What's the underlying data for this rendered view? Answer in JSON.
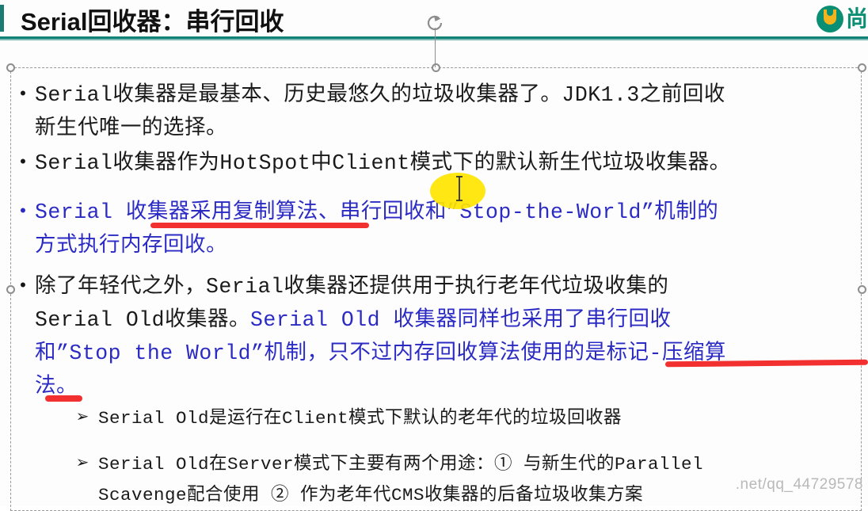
{
  "slide": {
    "title": "Serial回收器：串行回收",
    "brand": {
      "logo_icon": "shangguigu-logo-icon",
      "text": "尚"
    },
    "accent_color": "#0e8277",
    "blue_text_color": "#2b2bc4",
    "ink_color": "#f23030",
    "highlight_color": "#ffe500"
  },
  "bullets": [
    {
      "marker": "•",
      "line1": "Serial收集器是最基本、历史最悠久的垃圾收集器了。JDK1.3之前回收",
      "line2": "新生代唯一的选择。"
    },
    {
      "marker": "•",
      "line1": "Serial收集器作为HotSpot中Client模式下的默认新生代垃圾收集器。"
    },
    {
      "marker": "•",
      "line1": "Serial 收集器采用复制算法、串行回收和”Stop-the-World”机制的",
      "line2": "方式执行内存回收。"
    },
    {
      "marker": "•",
      "line1_black": "除了年轻代之外，Serial收集器还提供用于执行老年代垃圾收集的",
      "line2_black": "Serial Old收集器。",
      "line2_blue": "Serial Old 收集器同样也采用了串行回收",
      "line3_blue": "和”Stop the World”机制，只不过内存回收算法使用的是标记-压缩算",
      "line4_blue": "法。"
    }
  ],
  "subbullets": [
    {
      "marker": "➢",
      "line1": "Serial Old是运行在Client模式下默认的老年代的垃圾回收器"
    },
    {
      "marker": "➢",
      "line1": "Serial Old在Server模式下主要有两个用途：①  与新生代的Parallel",
      "line2": "Scavenge配合使用 ②  作为老年代CMS收集器的后备垃圾收集方案"
    }
  ],
  "watermark": {
    "text": ".net/qq_44729578"
  }
}
